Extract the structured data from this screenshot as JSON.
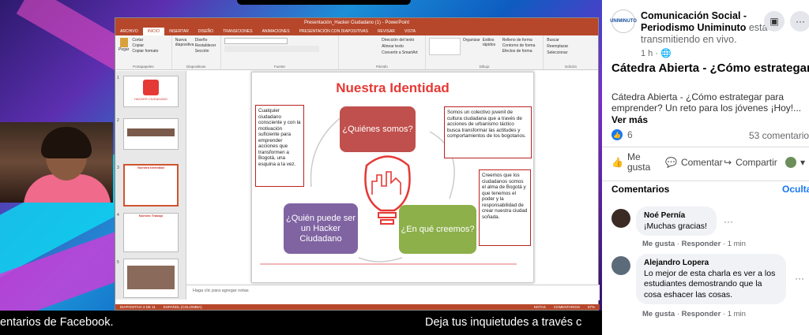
{
  "ppt": {
    "window_title": "Presentación_Hacker Ciudadano (1) - PowerPoint",
    "tabs": [
      "ARCHIVO",
      "INICIO",
      "INSERTAR",
      "DISEÑO",
      "TRANSICIONES",
      "ANIMACIONES",
      "PRESENTACIÓN CON DIAPOSITIVAS",
      "REVISAR",
      "VISTA"
    ],
    "ribbon": {
      "clipboard": {
        "paste": "Pegar",
        "cut": "Cortar",
        "copy": "Copiar",
        "format": "Copiar formato",
        "label": "Portapapeles"
      },
      "slides": {
        "new": "Nueva diapositiva",
        "layout": "Diseño",
        "reset": "Restablecer",
        "section": "Sección",
        "label": "Diapositivas"
      },
      "font_label": "Fuente",
      "paragraph": {
        "direction": "Dirección del texto",
        "align": "Alinear texto",
        "smartart": "Convertir a SmartArt",
        "label": "Párrafo"
      },
      "drawing": {
        "arrange": "Organizar",
        "styles": "Estilos rápidos",
        "fill": "Relleno de forma",
        "outline": "Contorno de forma",
        "effects": "Efectos de forma",
        "label": "Dibujo"
      },
      "editing": {
        "find": "Buscar",
        "replace": "Reemplazar",
        "select": "Seleccionar",
        "label": "Edición"
      }
    },
    "thumbnails": [
      {
        "num": "1",
        "text": "HACKER CIUDADANO"
      },
      {
        "num": "2",
        "text": ""
      },
      {
        "num": "3",
        "text": "Nuestra Identidad"
      },
      {
        "num": "4",
        "text": "Nuestro Trabajo"
      },
      {
        "num": "5",
        "text": ""
      }
    ],
    "slide": {
      "title": "Nuestra Identidad",
      "q1": "¿Quiénes somos?",
      "q2": "¿En qué creemos?",
      "q3": "¿Quién puede ser un Hacker Ciudadano",
      "t_left": "Cualquier ciudadano consciente y con la motivación suficiente para emprender acciones que transformen a Bogotá, una esquina a la vez.",
      "t_right_top": "Somos un colectivo juvenil de cultura ciudadana que a través de acciones de urbanismo táctico busca transformar las actitudes y comportamientos de los bogotanos.",
      "t_right_bottom": "Creemos que los ciudadanos somos el alma de Bogotá y que tenemos el poder y la responsabilidad de crear nuestra ciudad soñada."
    },
    "notes_placeholder": "Haga clic para agregar notas",
    "status": {
      "slide": "DIAPOSITIVA 3 DE 11",
      "lang": "ESPAÑOL (COLOMBIA)",
      "notes": "NOTAS",
      "comments": "COMENTARIOS",
      "zoom": "87%"
    }
  },
  "captions": {
    "left": "entarios de Facebook.",
    "right": "Deja tus inquietudes a través c"
  },
  "fb": {
    "page_name": "Comunicación Social - Periodismo Uniminuto",
    "status_suffix": "está transmitiendo en vivo.",
    "time": "1 h",
    "video_title": "Cátedra Abierta - ¿Cómo estrategar para emprender? Un...",
    "description": "Cátedra Abierta - ¿Cómo estrategar para emprender? Un reto para los jóvenes ¡Hoy!...",
    "see_more": "Ver más",
    "like_count": "6",
    "comment_count": "53 comentarios",
    "actions": {
      "like": "Me gusta",
      "comment": "Comentar",
      "share": "Compartir"
    },
    "comments_header": "Comentarios",
    "hide": "Ocultar",
    "comments": [
      {
        "author": "Noé Pernía",
        "text": "¡Muchas gracias!",
        "like": "Me gusta",
        "reply": "Responder",
        "time": "1 min"
      },
      {
        "author": "Alejandro Lopera",
        "text": "Lo mejor de esta charla es ver a los estudiantes demostrando que la cosa eshacer las cosas.",
        "like": "Me gusta",
        "reply": "Responder",
        "time": "1 min"
      }
    ]
  }
}
